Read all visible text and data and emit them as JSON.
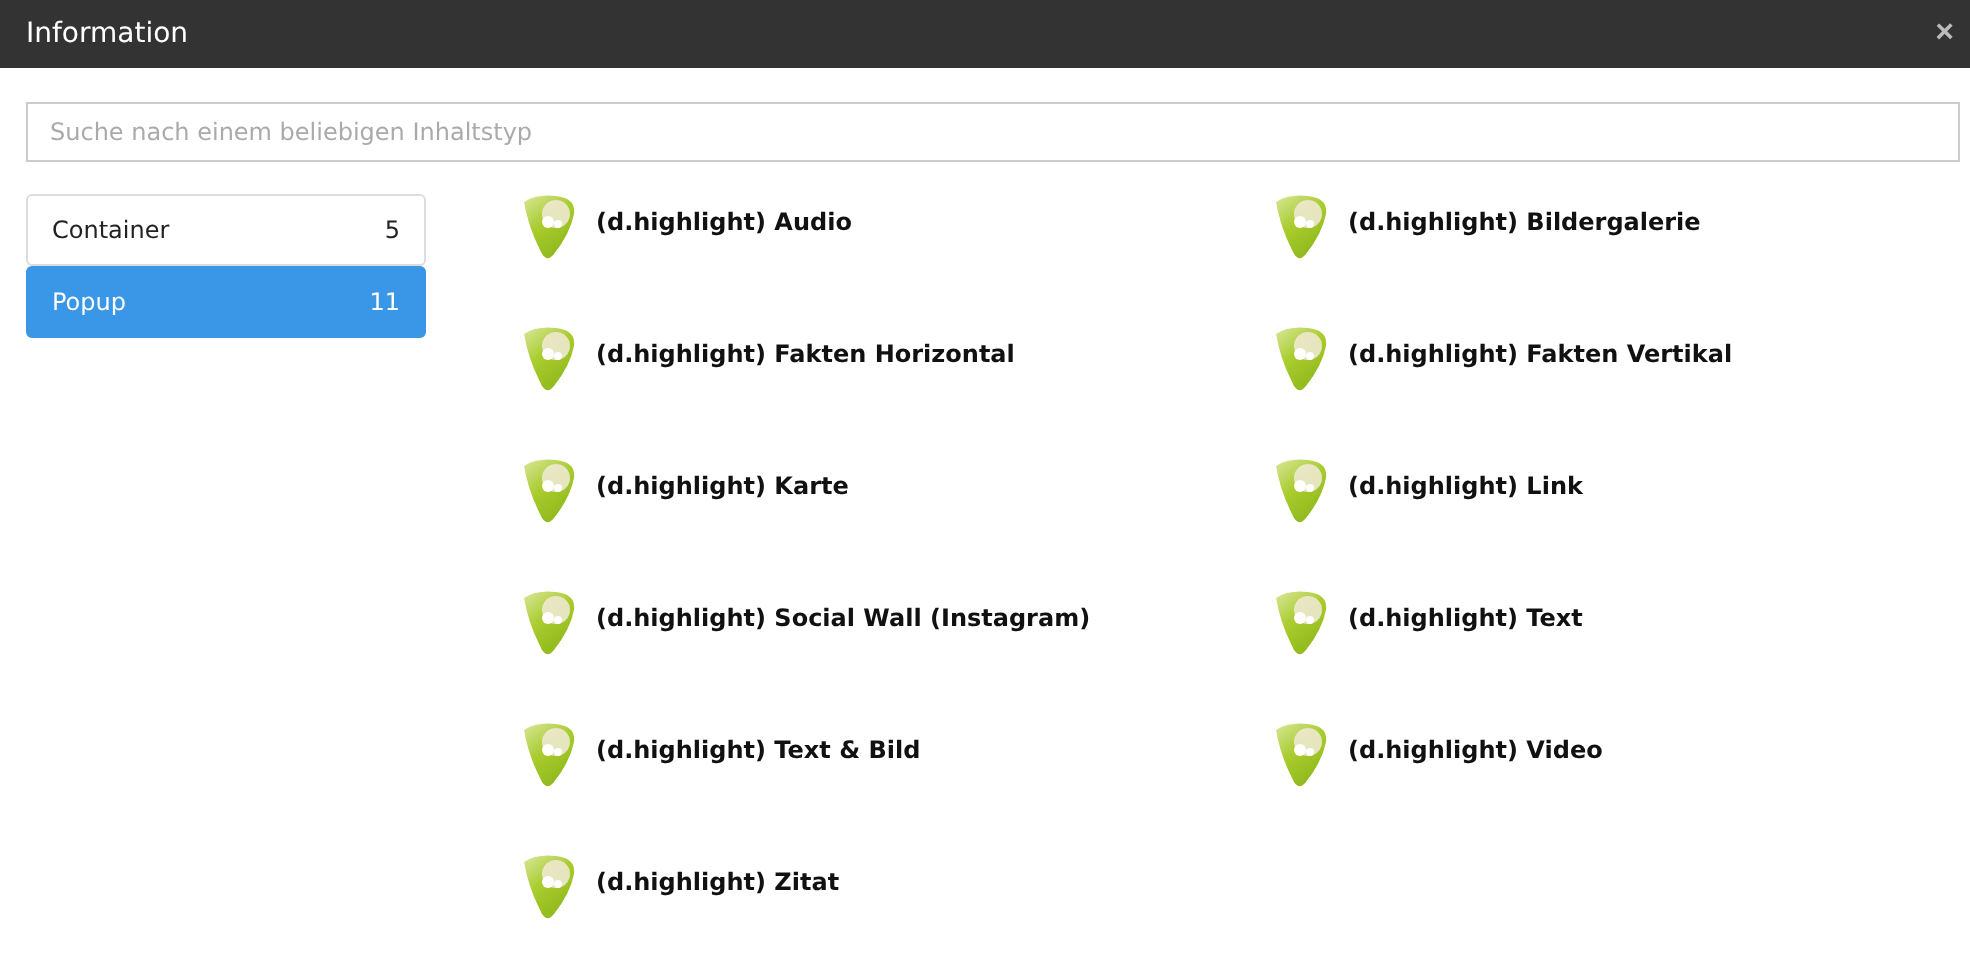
{
  "window": {
    "title": "Information",
    "close": "×"
  },
  "search": {
    "placeholder": "Suche nach einem beliebigen Inhaltstyp"
  },
  "categories": [
    {
      "label": "Container",
      "count": "5",
      "selected": false
    },
    {
      "label": "Popup",
      "count": "11",
      "selected": true
    }
  ],
  "content_types": [
    "(d.highlight) Audio",
    "(d.highlight) Bildergalerie",
    "(d.highlight) Fakten Horizontal",
    "(d.highlight) Fakten Vertikal",
    "(d.highlight) Karte",
    "(d.highlight) Link",
    "(d.highlight) Social Wall (Instagram)",
    "(d.highlight) Text",
    "(d.highlight) Text & Bild",
    "(d.highlight) Video",
    "(d.highlight) Zitat"
  ]
}
